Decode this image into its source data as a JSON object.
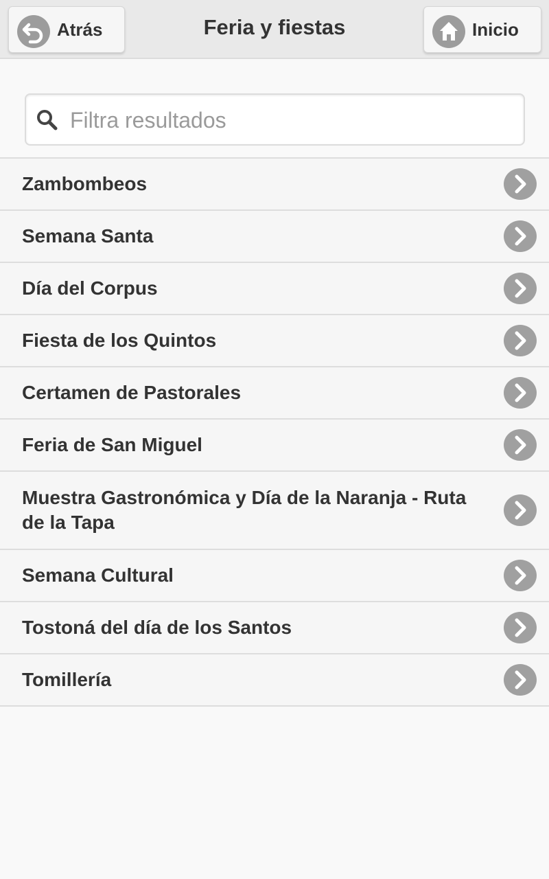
{
  "header": {
    "title": "Feria y fiestas",
    "back_label": "Atrás",
    "home_label": "Inicio",
    "back_icon": "back-arrow-icon",
    "home_icon": "home-icon"
  },
  "search": {
    "placeholder": "Filtra resultados",
    "value": "",
    "icon": "search-icon"
  },
  "list": {
    "items": [
      {
        "label": "Zambombeos"
      },
      {
        "label": "Semana Santa"
      },
      {
        "label": "Día del Corpus"
      },
      {
        "label": "Fiesta de los Quintos"
      },
      {
        "label": "Certamen de Pastorales"
      },
      {
        "label": "Feria de San Miguel"
      },
      {
        "label": "Muestra Gastronómica y Día de la Naranja - Ruta de la Tapa"
      },
      {
        "label": "Semana Cultural"
      },
      {
        "label": "Tostoná del día de los Santos"
      },
      {
        "label": "Tomillería"
      }
    ],
    "item_icon": "chevron-right-icon"
  },
  "colors": {
    "header_bg": "#e9e9e9",
    "list_bg": "#f6f6f6",
    "icon_circle": "#a0a0a0",
    "text": "#333333"
  }
}
